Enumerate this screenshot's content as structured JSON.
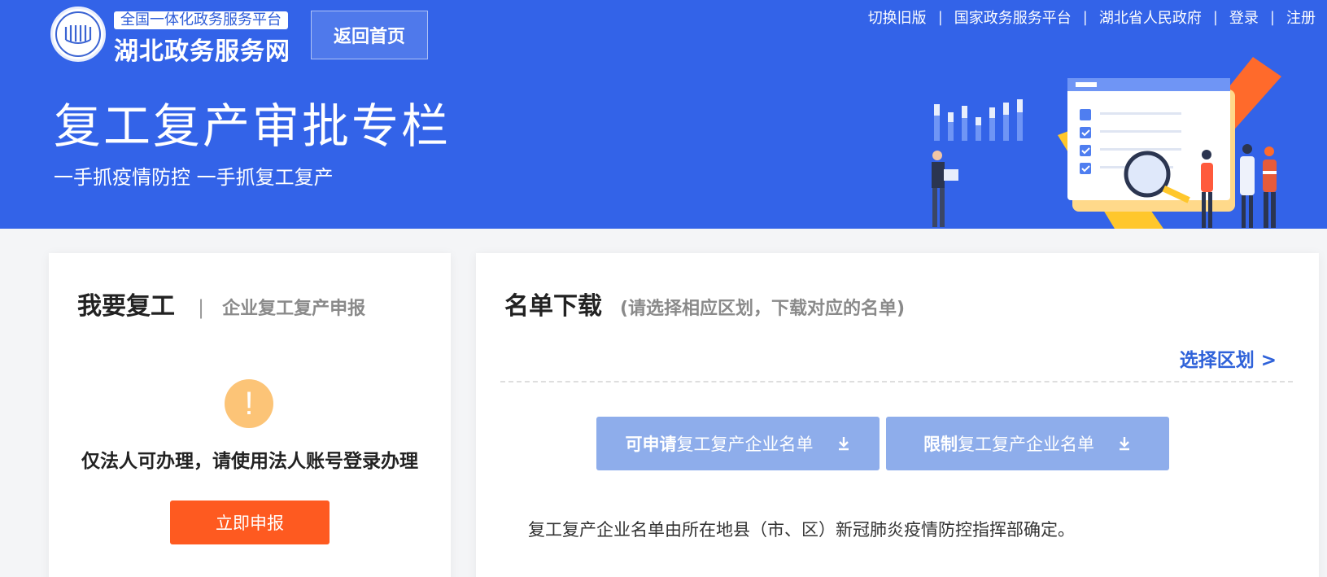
{
  "header": {
    "logo_label": "湖北政务服务网 logo",
    "platform_tag": "全国一体化政务服务平台",
    "site_name": "湖北政务服务网",
    "back_home": "返回首页",
    "top_links": [
      "切换旧版",
      "国家政务服务平台",
      "湖北省人民政府",
      "登录",
      "注册"
    ],
    "separator": "|"
  },
  "banner": {
    "title": "复工复产审批专栏",
    "subtitle": "一手抓疫情防控  一手抓复工复产",
    "illustration": "business-approval-illustration"
  },
  "left_card": {
    "title": "我要复工",
    "divider": "|",
    "subtitle": "企业复工复产申报",
    "warning_icon": "!",
    "warning_text": "仅法人可办理，请使用法人账号登录办理",
    "apply_button": "立即申报"
  },
  "right_card": {
    "title": "名单下载",
    "hint": "(请选择相应区划，下载对应的名单)",
    "select_region": "选择区划  >",
    "download_buttons": [
      {
        "bold": "可申请",
        "text": "复工复产企业名单"
      },
      {
        "bold": "限制",
        "text": "复工复产企业名单"
      }
    ],
    "note": "复工复产企业名单由所在地县（市、区）新冠肺炎疫情防控指挥部确定。"
  },
  "colors": {
    "banner_blue": "#3363e8",
    "accent_orange": "#fe5a20",
    "warning_orange": "#fcc477",
    "download_button_blue": "#8eadeb",
    "link_blue": "#2f62d9"
  },
  "icons": [
    "emblem-icon",
    "warning-icon",
    "download-icon",
    "chevron-right-icon"
  ]
}
